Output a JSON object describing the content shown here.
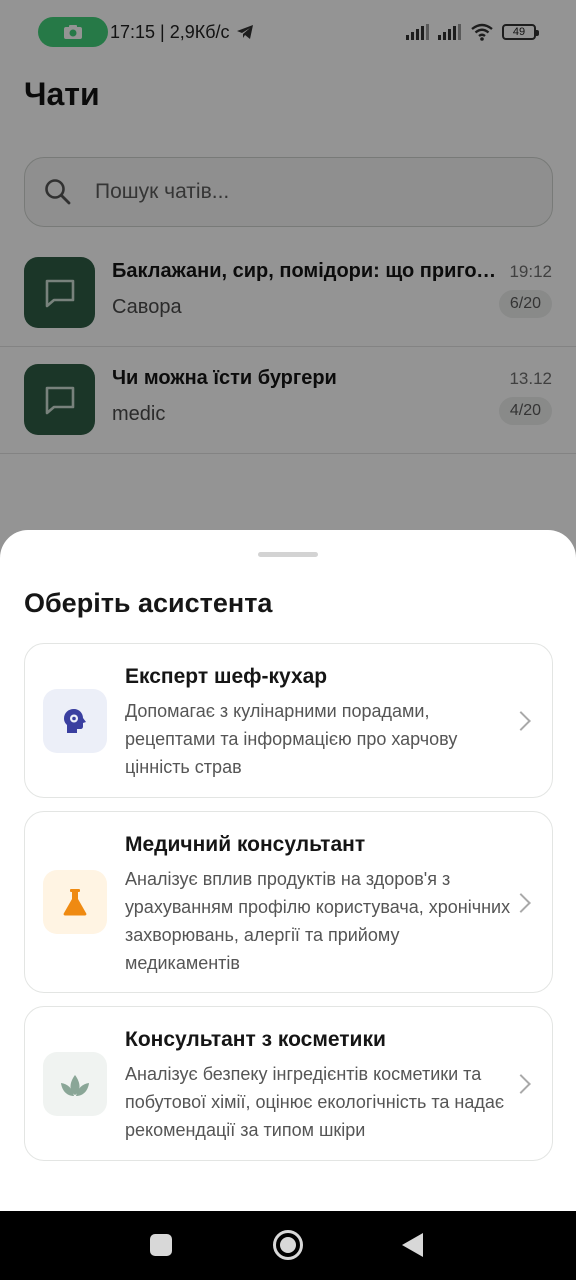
{
  "status_bar": {
    "time_speed": "17:15 | 2,9Кб/с",
    "battery": "49"
  },
  "chats": {
    "title": "Чати",
    "search_placeholder": "Пошук чатів...",
    "items": [
      {
        "title": "Баклажани, сир, помідори: що приготувати",
        "subtitle": "Савора",
        "time": "19:12",
        "count": "6/20"
      },
      {
        "title": "Чи можна їсти бургери",
        "subtitle": "medic",
        "time": "13.12",
        "count": "4/20"
      }
    ]
  },
  "sheet": {
    "title": "Оберіть асистента",
    "assistants": [
      {
        "title": "Експерт шеф-кухар",
        "description": "Допомагає з кулінарними порадами, рецептами та інформацією про харчову цінність страв",
        "icon": "head-gear-icon",
        "icon_bg": "#eceff8",
        "icon_color": "#3a3fa0"
      },
      {
        "title": "Медичний консультант",
        "description": "Аналізує вплив продуктів на здоров'я з урахуванням профілю користувача, хронічних захворювань, алергії та прийому медикаментів",
        "icon": "flask-icon",
        "icon_bg": "#fff4e3",
        "icon_color": "#ef8a12"
      },
      {
        "title": "Консультант з косметики",
        "description": "Аналізує безпеку інгредієнтів косметики та побутової хімії, оцінює екологічність та надає рекомендації за типом шкіри",
        "icon": "leaf-icon",
        "icon_bg": "#f0f3f1",
        "icon_color": "#8aa697"
      }
    ]
  },
  "colors": {
    "brand": "#2f5d45",
    "recording": "#43d17a"
  }
}
